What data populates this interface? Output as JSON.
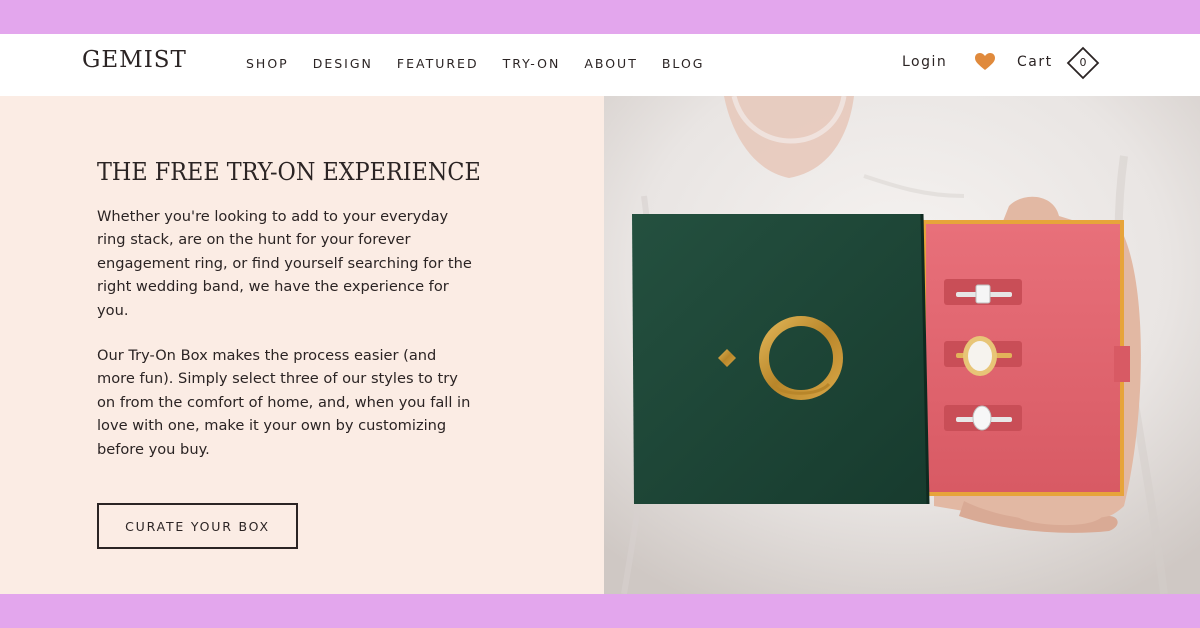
{
  "brand": {
    "logo": "GEMIST"
  },
  "nav": {
    "items": [
      "SHOP",
      "DESIGN",
      "FEATURED",
      "TRY-ON",
      "ABOUT",
      "BLOG"
    ]
  },
  "header_actions": {
    "login": "Login",
    "cart_label": "Cart",
    "cart_count": "0"
  },
  "hero": {
    "title": "THE FREE TRY-ON EXPERIENCE",
    "paragraph1": "Whether you're looking to add to your everyday ring stack, are on the hunt for your forever engagement ring, or find yourself searching for the right wedding band, we have the experience for you.",
    "paragraph2": "Our Try-On Box makes the process easier (and more fun). Simply select three of our styles to try on from the comfort of home, and, when you fall in love with one, make it your own by customizing before you buy.",
    "cta_label": "CURATE YOUR BOX"
  },
  "colors": {
    "band": "#e3a6ed",
    "panel": "#fbece4",
    "text": "#2b2424",
    "heart": "#e08a3c",
    "box_green": "#1f4a3a",
    "box_pink": "#e0646d",
    "gold": "#c9962e"
  },
  "icons": {
    "wishlist": "heart-icon",
    "cart": "diamond-cart-icon"
  }
}
